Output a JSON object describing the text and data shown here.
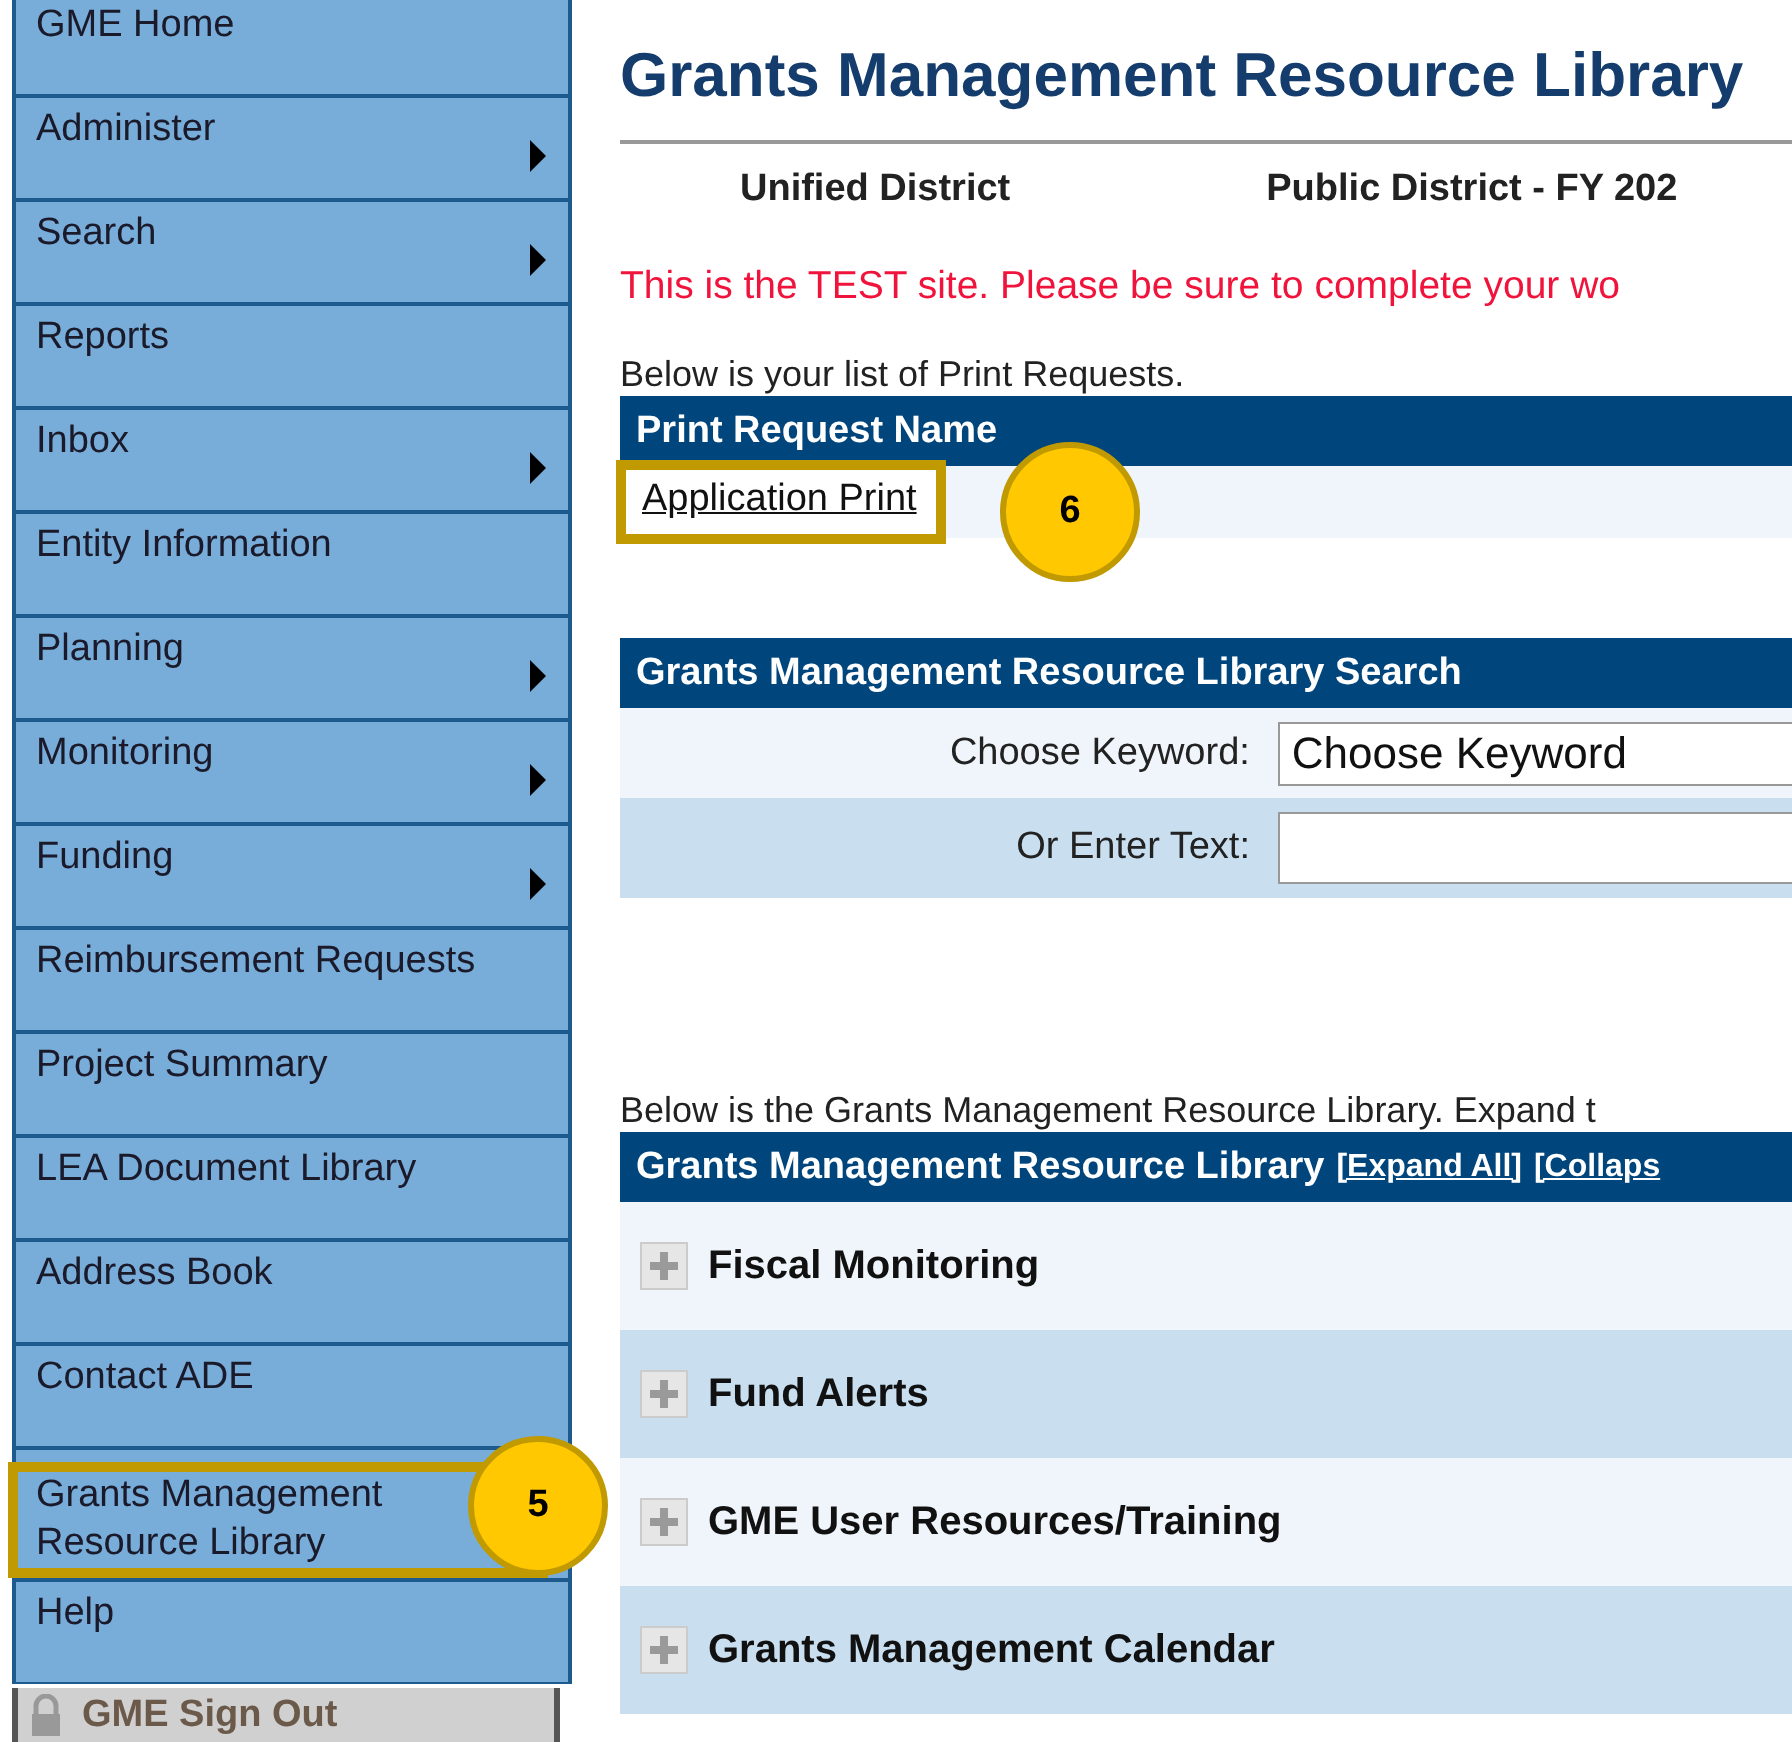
{
  "sidebar": {
    "items": [
      {
        "label": "GME Home",
        "has_submenu": false
      },
      {
        "label": "Administer",
        "has_submenu": true
      },
      {
        "label": "Search",
        "has_submenu": true
      },
      {
        "label": "Reports",
        "has_submenu": false
      },
      {
        "label": "Inbox",
        "has_submenu": true
      },
      {
        "label": "Entity Information",
        "has_submenu": false
      },
      {
        "label": "Planning",
        "has_submenu": true
      },
      {
        "label": "Monitoring",
        "has_submenu": true
      },
      {
        "label": "Funding",
        "has_submenu": true
      },
      {
        "label": "Reimbursement Requests",
        "has_submenu": false
      },
      {
        "label": "Project Summary",
        "has_submenu": false
      },
      {
        "label": "LEA Document Library",
        "has_submenu": false
      },
      {
        "label": "Address Book",
        "has_submenu": false
      },
      {
        "label": "Contact ADE",
        "has_submenu": false
      },
      {
        "label": "Grants Management Resource Library",
        "callout": "5"
      },
      {
        "label": "Help",
        "has_submenu": false
      }
    ],
    "sign_out": "GME Sign Out"
  },
  "page_title": "Grants Management Resource Library",
  "district": {
    "name": "Unified District",
    "program": "Public District - FY 202"
  },
  "test_notice": "This is the TEST site. Please be sure to complete your wo",
  "print_requests": {
    "intro": "Below is your list of Print Requests.",
    "column": "Print Request Name",
    "rows": [
      {
        "label": "Application Print",
        "callout": "6"
      }
    ]
  },
  "search": {
    "title": "Grants Management Resource Library Search",
    "keyword_label": "Choose Keyword:",
    "keyword_value": "Choose Keyword",
    "text_label": "Or Enter Text:"
  },
  "library": {
    "intro": "Below is the Grants Management Resource Library. Expand t",
    "title": "Grants Management Resource Library",
    "links": [
      "[Expand All]",
      "[Collaps"
    ],
    "sections": [
      {
        "label": "Fiscal Monitoring",
        "expanded": false
      },
      {
        "label": "Fund Alerts",
        "expanded": false
      },
      {
        "label": "GME User Resources/Training",
        "expanded": false
      },
      {
        "label": "Grants Management Calendar",
        "expanded": false
      }
    ]
  }
}
